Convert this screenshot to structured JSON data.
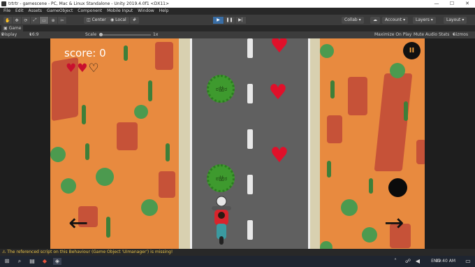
{
  "window": {
    "title": "trtrtr - gamescene - PC, Mac & Linux Standalone - Unity 2019.4.0f1 <DX11>"
  },
  "menu": [
    "File",
    "Edit",
    "Assets",
    "GameObject",
    "Component",
    "Mobile Input",
    "Window",
    "Help"
  ],
  "toolbar": {
    "center_label": "Center",
    "local_label": "Local",
    "collab_label": "Collab",
    "account_label": "Account",
    "layers_label": "Layers",
    "layout_label": "Layout"
  },
  "game_view": {
    "tab_label": "Game",
    "display_label": "Display 1",
    "aspect_label": "16:9",
    "scale_label": "Scale",
    "scale_value": "1x",
    "maximize_label": "Maximize On Play",
    "mute_label": "Mute Audio",
    "stats_label": "Stats",
    "gizmos_label": "Gizmos"
  },
  "game": {
    "score_text": "score: 0",
    "lives_total": 3,
    "lives_remaining": 2,
    "pause_glyph": "II"
  },
  "status_message": "The referenced script on this Behaviour (Game Object 'UImanager') is missing!",
  "taskbar": {
    "lang": "ENG",
    "time": "09:40 AM"
  },
  "colors": {
    "road": "#606060",
    "desert": "#e8873f",
    "heart": "#e0102a",
    "virus": "#3e9a2e",
    "pause_fg": "#f2a03d"
  }
}
